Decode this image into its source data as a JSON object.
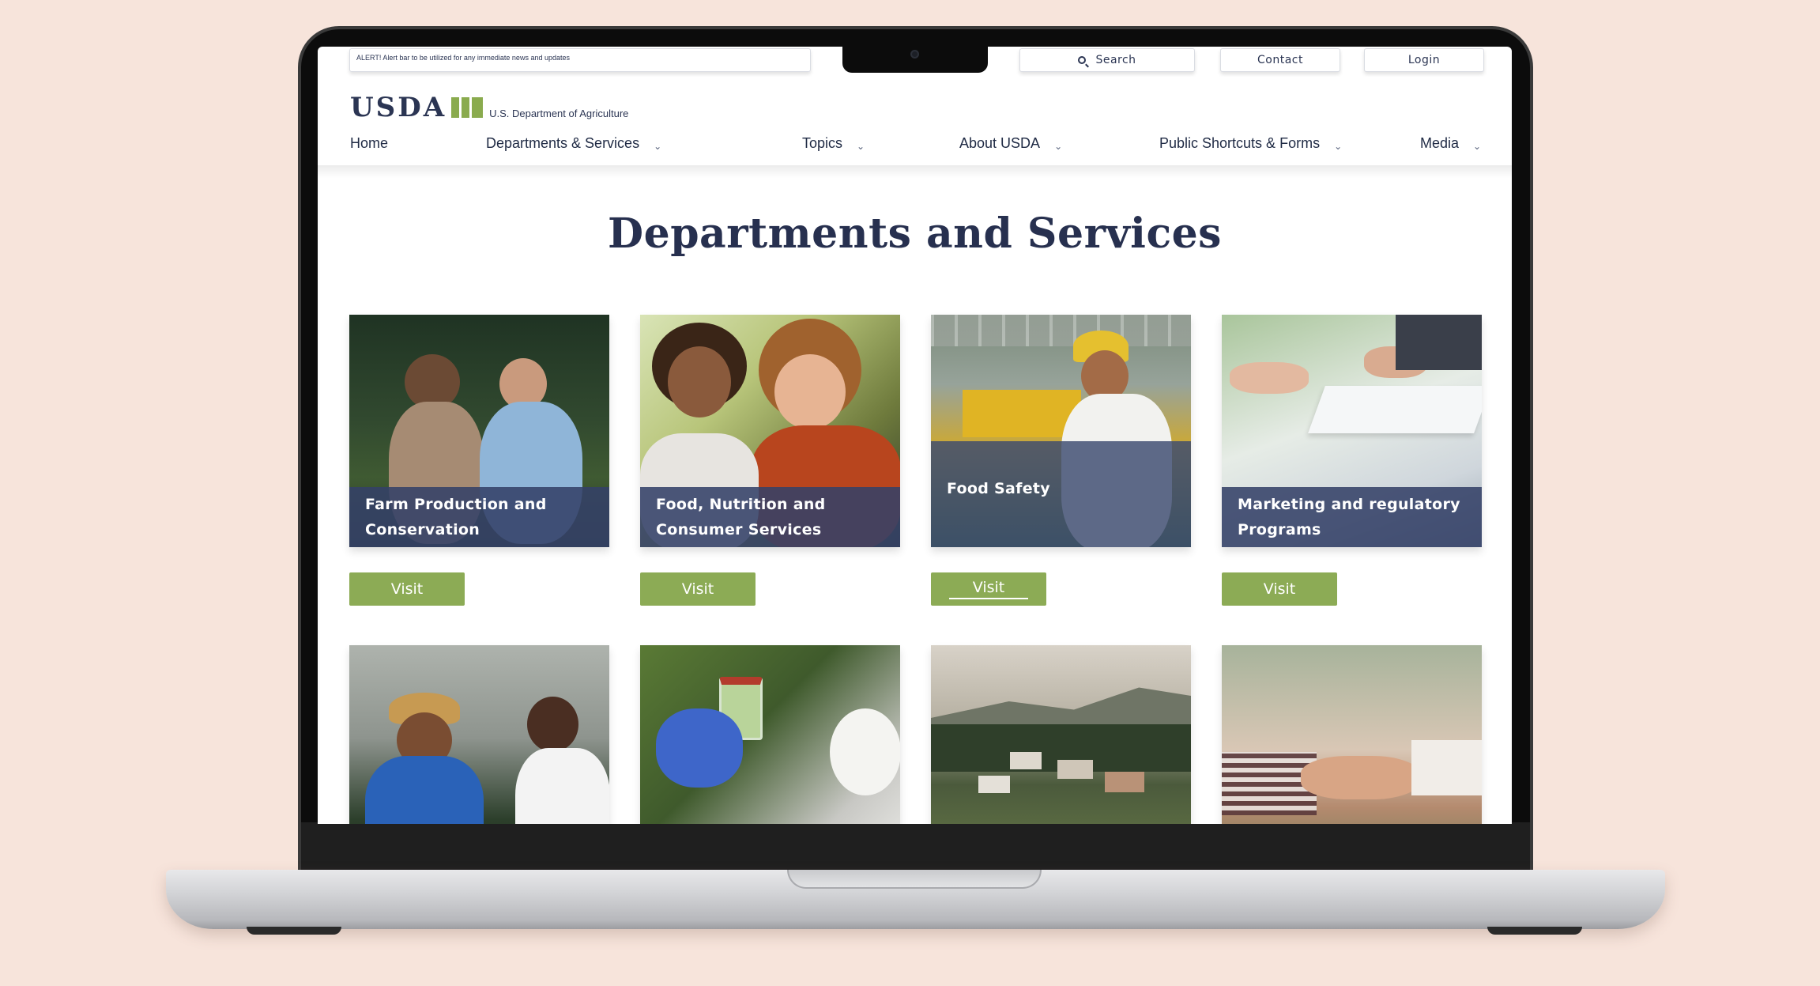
{
  "alert": {
    "text": "ALERT! Alert bar to be utilized for any immediate news and updates"
  },
  "utility": {
    "search_label": "Search",
    "contact_label": "Contact",
    "login_label": "Login"
  },
  "logo": {
    "wordmark": "USDA",
    "subtitle": "U.S. Department of Agriculture"
  },
  "nav": {
    "items": [
      {
        "label": "Home",
        "has_dropdown": false
      },
      {
        "label": "Departments & Services",
        "has_dropdown": true
      },
      {
        "label": "Topics",
        "has_dropdown": true
      },
      {
        "label": "About USDA",
        "has_dropdown": true
      },
      {
        "label": "Public Shortcuts & Forms",
        "has_dropdown": true
      },
      {
        "label": "Media",
        "has_dropdown": true
      }
    ]
  },
  "page": {
    "title": "Departments and Services"
  },
  "cards": [
    {
      "title_line1": "Farm Production and",
      "title_line2": "Conservation",
      "button": "Visit"
    },
    {
      "title_line1": "Food, Nutrition and",
      "title_line2": "Consumer Services",
      "button": "Visit"
    },
    {
      "title_line1": "Food Safety",
      "title_line2": "",
      "button": "Visit"
    },
    {
      "title_line1": "Marketing and regulatory",
      "title_line2": "Programs",
      "button": "Visit"
    }
  ],
  "colors": {
    "navy": "#2b3553",
    "green": "#8cab55",
    "caption_overlay": "#344168",
    "background": "#f7e4db"
  },
  "icons": {
    "search": "magnifier-icon",
    "dropdown": "chevron-down-icon"
  }
}
